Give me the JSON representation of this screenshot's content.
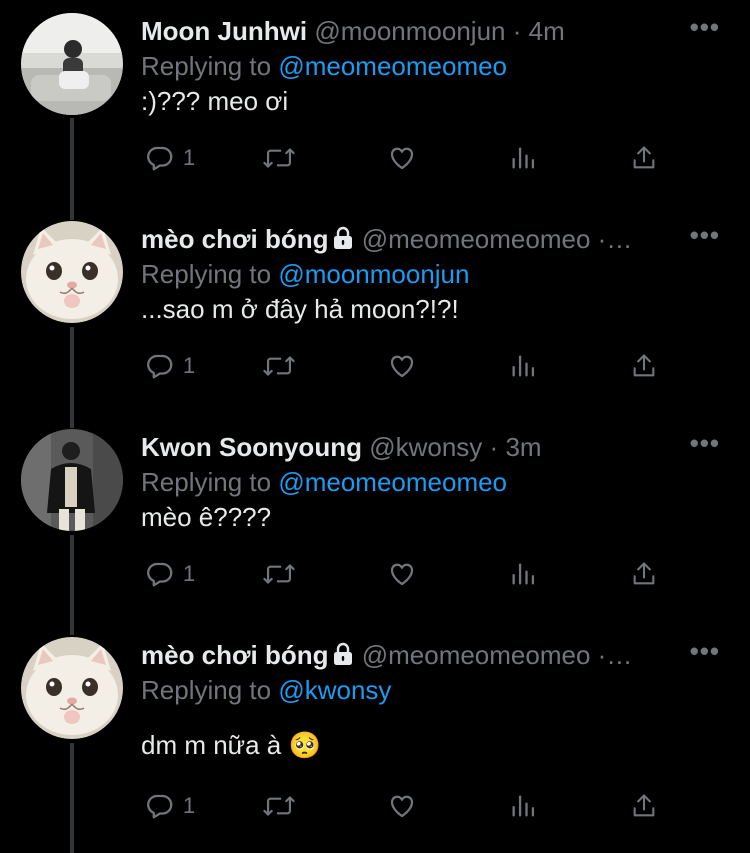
{
  "tweets": [
    {
      "name": "Moon Junhwi",
      "handle": "@moonmoonjun",
      "separator": "·",
      "time": "4m",
      "replying_prefix": "Replying to",
      "replying_to": "@meomeomeomeo",
      "text": ":)??? meo ơi",
      "reply_count": "1",
      "locked": false,
      "avatar": "person-sitting-avatar",
      "more_icon": "more-icon"
    },
    {
      "name": "mèo chơi bóng",
      "handle": "@meomeomeomeo",
      "separator": "·",
      "time": "…",
      "replying_prefix": "Replying to",
      "replying_to": "@moonmoonjun",
      "text": "...sao m ở đây hả moon?!?!",
      "reply_count": "1",
      "locked": true,
      "avatar": "white-cat-avatar",
      "more_icon": "more-icon"
    },
    {
      "name": "Kwon Soonyoung",
      "handle": "@kwonsy",
      "separator": "·",
      "time": "3m",
      "replying_prefix": "Replying to",
      "replying_to": "@meomeomeomeo",
      "text": "mèo ê????",
      "reply_count": "1",
      "locked": false,
      "avatar": "person-leather-jacket-avatar",
      "more_icon": "more-icon"
    },
    {
      "name": "mèo chơi bóng",
      "handle": "@meomeomeomeo",
      "separator": "·",
      "time": "…",
      "replying_prefix": "Replying to",
      "replying_to": "@kwonsy",
      "text": "dm m nữa à 🥺",
      "reply_count": "1",
      "locked": true,
      "avatar": "white-cat-avatar",
      "more_icon": "more-icon"
    }
  ],
  "actions": [
    "reply-icon",
    "retweet-icon",
    "like-icon",
    "analytics-icon",
    "share-icon"
  ],
  "more_label": "•••",
  "colors": {
    "background": "#000000",
    "text": "#e7e9ea",
    "muted": "#71767b",
    "mention": "#1d9bf0",
    "thread_line": "#333639"
  }
}
